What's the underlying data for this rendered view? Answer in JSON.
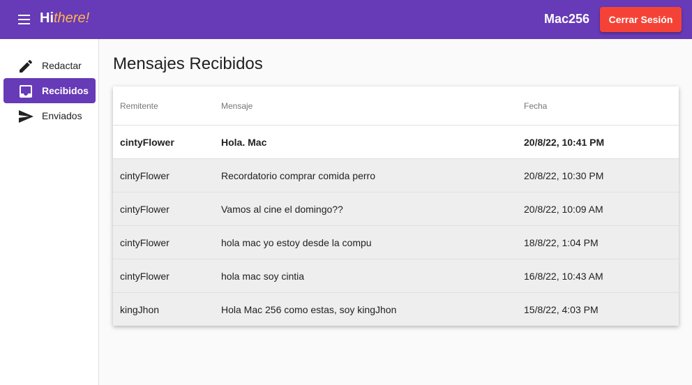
{
  "header": {
    "brand_prefix": "Hi",
    "brand_accent": "there!",
    "username": "Mac256",
    "logout_label": "Cerrar Sesión",
    "accent_color": "#673ab7",
    "logout_color": "#f44336"
  },
  "sidebar": {
    "items": [
      {
        "label": "Redactar",
        "icon": "pencil-icon",
        "active": false
      },
      {
        "label": "Recibidos",
        "icon": "inbox-icon",
        "active": true
      },
      {
        "label": "Enviados",
        "icon": "send-icon",
        "active": false
      }
    ]
  },
  "main": {
    "title": "Mensajes Recibidos",
    "columns": [
      "Remitente",
      "Mensaje",
      "Fecha"
    ],
    "rows": [
      {
        "sender": "cintyFlower",
        "message": "Hola. Mac",
        "date": "20/8/22, 10:41 PM",
        "unread": true
      },
      {
        "sender": "cintyFlower",
        "message": "Recordatorio comprar comida perro",
        "date": "20/8/22, 10:30 PM",
        "unread": false
      },
      {
        "sender": "cintyFlower",
        "message": "Vamos al cine el domingo??",
        "date": "20/8/22, 10:09 AM",
        "unread": false
      },
      {
        "sender": "cintyFlower",
        "message": "hola mac yo estoy desde la compu",
        "date": "18/8/22, 1:04 PM",
        "unread": false
      },
      {
        "sender": "cintyFlower",
        "message": "hola mac soy cintia",
        "date": "16/8/22, 10:43 AM",
        "unread": false
      },
      {
        "sender": "kingJhon",
        "message": "Hola Mac 256 como estas, soy kingJhon",
        "date": "15/8/22, 4:03 PM",
        "unread": false
      }
    ]
  }
}
